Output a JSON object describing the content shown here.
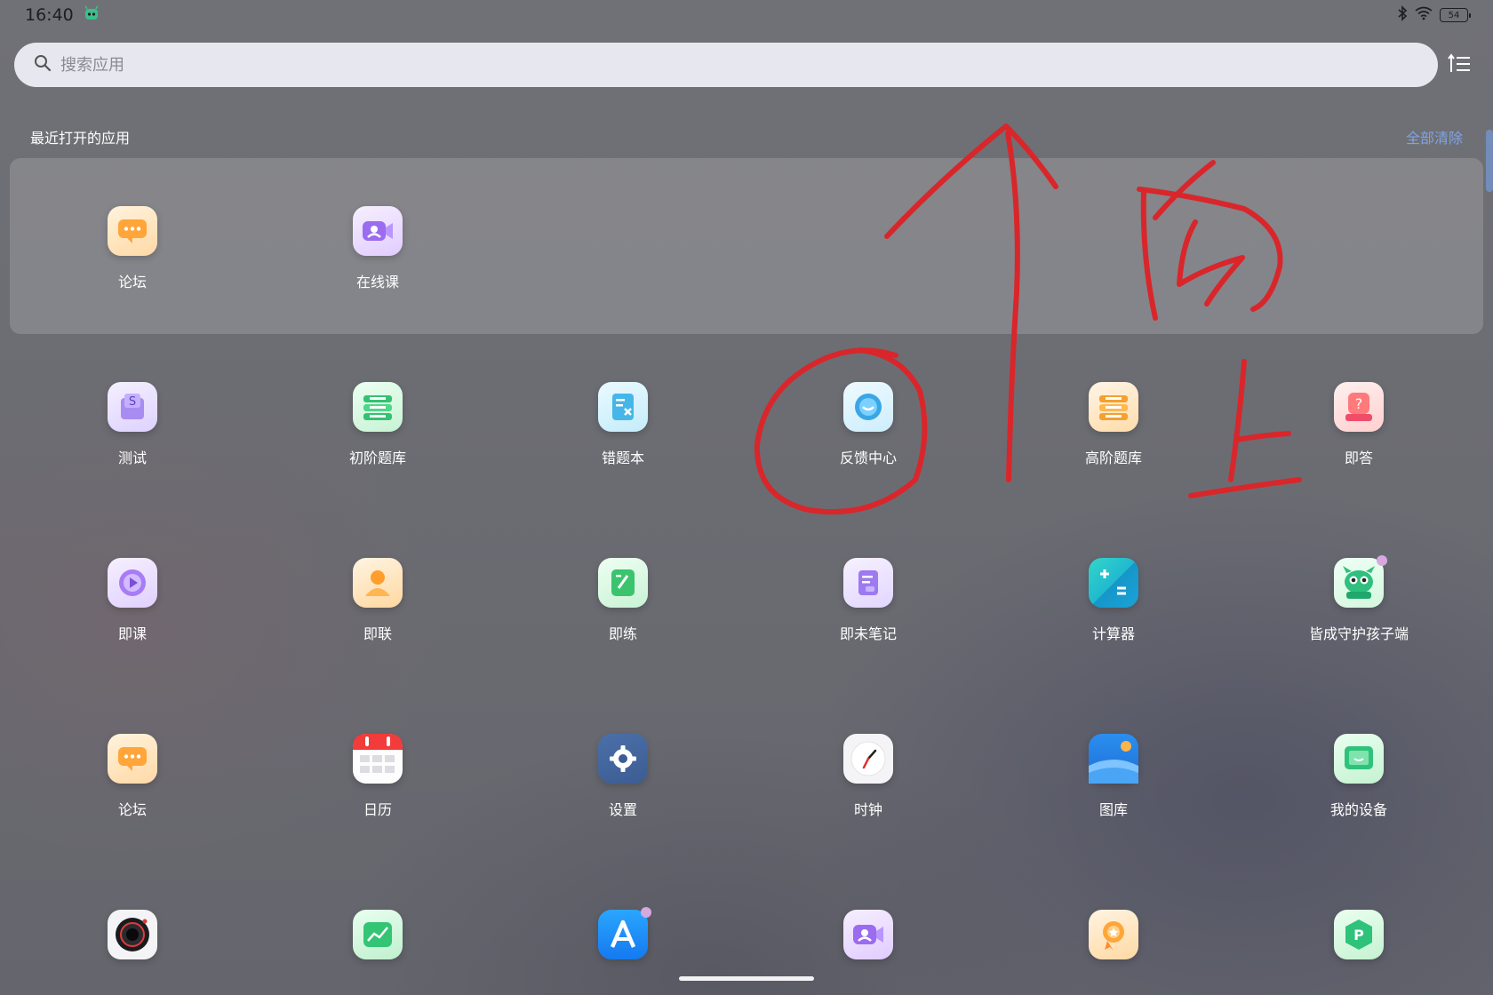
{
  "status": {
    "time": "16:40",
    "battery": "54"
  },
  "search": {
    "placeholder": "搜索应用"
  },
  "recent": {
    "title": "最近打开的应用",
    "clear_label": "全部清除",
    "apps": [
      {
        "label": "论坛",
        "icon": "forum-icon"
      },
      {
        "label": "在线课",
        "icon": "online-class-icon"
      }
    ]
  },
  "apps": [
    {
      "label": "测试",
      "icon": "test-icon"
    },
    {
      "label": "初阶题库",
      "icon": "basic-question-bank-icon"
    },
    {
      "label": "错题本",
      "icon": "mistake-book-icon"
    },
    {
      "label": "反馈中心",
      "icon": "feedback-icon"
    },
    {
      "label": "高阶题库",
      "icon": "advanced-question-bank-icon"
    },
    {
      "label": "即答",
      "icon": "quick-answer-icon"
    },
    {
      "label": "即课",
      "icon": "play-lesson-icon"
    },
    {
      "label": "即联",
      "icon": "contact-icon"
    },
    {
      "label": "即练",
      "icon": "practice-icon"
    },
    {
      "label": "即未笔记",
      "icon": "notes-icon"
    },
    {
      "label": "计算器",
      "icon": "calculator-icon"
    },
    {
      "label": "皆成守护孩子端",
      "icon": "child-guard-icon"
    },
    {
      "label": "论坛",
      "icon": "forum-icon"
    },
    {
      "label": "日历",
      "icon": "calendar-icon"
    },
    {
      "label": "设置",
      "icon": "settings-icon"
    },
    {
      "label": "时钟",
      "icon": "clock-icon"
    },
    {
      "label": "图库",
      "icon": "gallery-icon"
    },
    {
      "label": "我的设备",
      "icon": "my-device-icon"
    },
    {
      "label": "",
      "icon": "camera-icon"
    },
    {
      "label": "",
      "icon": "chart-app-icon"
    },
    {
      "label": "",
      "icon": "app-store-icon"
    },
    {
      "label": "",
      "icon": "online-class-icon"
    },
    {
      "label": "",
      "icon": "award-icon"
    },
    {
      "label": "",
      "icon": "parking-icon"
    }
  ],
  "colors": {
    "annotation": "#d9262b",
    "clear_link": "#7fa3e6",
    "search_bg": "#e7e8ef"
  },
  "annotation_text": "向上"
}
